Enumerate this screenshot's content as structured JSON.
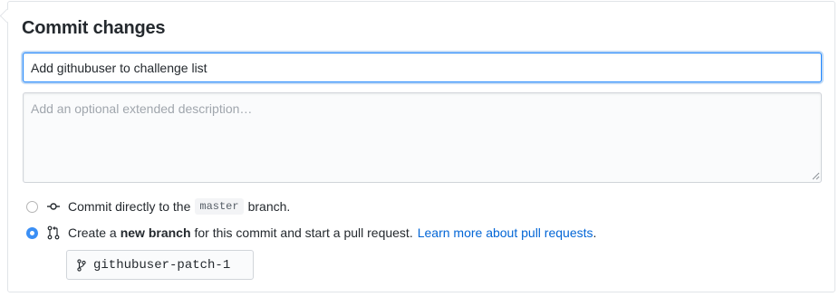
{
  "form": {
    "title": "Commit changes",
    "summary_value": "Add githubuser to challenge list",
    "description_placeholder": "Add an optional extended description…",
    "description_value": ""
  },
  "options": {
    "direct": {
      "selected": false,
      "prefix": "Commit directly to the",
      "branch": "master",
      "suffix": "branch."
    },
    "new_branch": {
      "selected": true,
      "prefix": "Create a",
      "emphasis": "new branch",
      "suffix": "for this commit and start a pull request.",
      "link": "Learn more about pull requests",
      "trailing": "."
    }
  },
  "branch_name": "githubuser-patch-1",
  "icons": {
    "commit": "git-commit-icon",
    "pull_request": "git-pull-request-icon",
    "branch": "git-branch-icon"
  },
  "colors": {
    "accent": "#2188ff",
    "radio_selected": "#3b8ff5",
    "link": "#0366d6"
  }
}
